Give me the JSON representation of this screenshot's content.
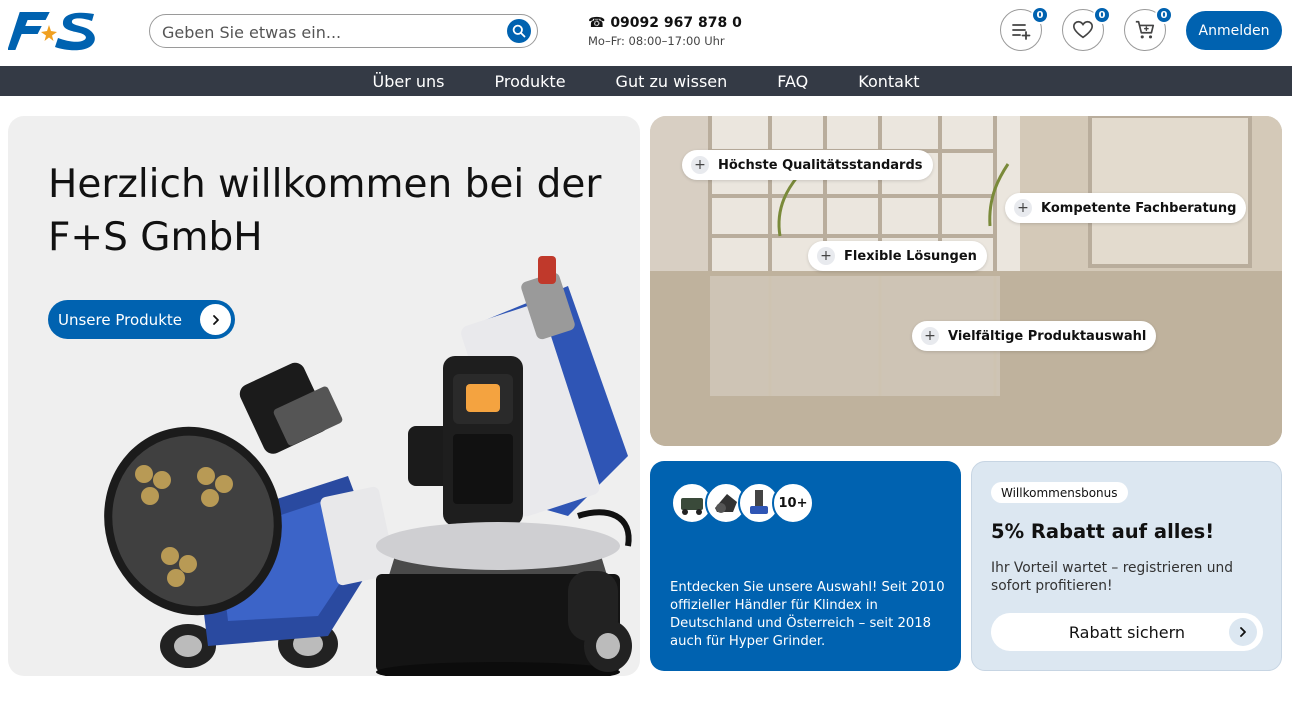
{
  "brand": {
    "logo_text": "F+S",
    "accent": "#0062b0",
    "nav_bg": "#343a45",
    "logo_star": "#f0a020"
  },
  "search": {
    "placeholder": "Geben Sie etwas ein..."
  },
  "contact": {
    "phone": "☎ 09092 967 878 0",
    "hours": "Mo–Fr: 08:00–17:00 Uhr"
  },
  "header_actions": {
    "compare_count": "0",
    "wishlist_count": "0",
    "cart_count": "0",
    "login_label": "Anmelden"
  },
  "nav": {
    "items": [
      "Über uns",
      "Produkte",
      "Gut zu wissen",
      "FAQ",
      "Kontakt"
    ]
  },
  "hero": {
    "title": "Herzlich willkommen bei der F+S GmbH",
    "button_label": "Unsere Produkte"
  },
  "features": {
    "items": [
      "Höchste Qualitätsstandards",
      "Kompetente Fachberatung",
      "Flexible Lösungen",
      "Vielfältige Produktauswahl"
    ]
  },
  "selection_card": {
    "more_label": "10+",
    "text": "Entdecken Sie unsere Auswahl! Seit 2010 offizieller Händler für Klindex in Deutschland und Österreich – seit 2018 auch für Hyper Grinder."
  },
  "bonus_card": {
    "tag": "Willkommensbonus",
    "title": "5% Rabatt auf alles!",
    "text": "Ihr Vorteil wartet – registrieren und sofort profitieren!",
    "button_label": "Rabatt sichern"
  }
}
